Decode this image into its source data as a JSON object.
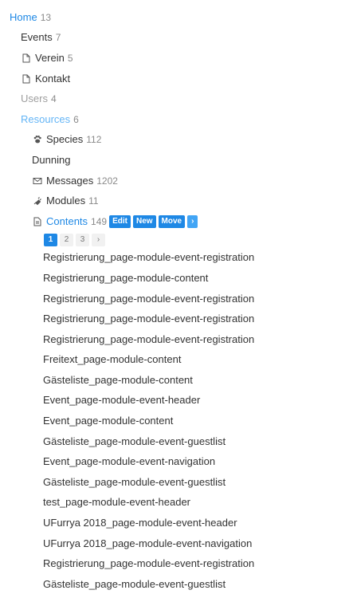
{
  "tree": {
    "home": {
      "label": "Home",
      "count": "13"
    },
    "events": {
      "label": "Events",
      "count": "7"
    },
    "verein": {
      "label": "Verein",
      "count": "5"
    },
    "kontakt": {
      "label": "Kontakt"
    },
    "users": {
      "label": "Users",
      "count": "4"
    },
    "resources": {
      "label": "Resources",
      "count": "6"
    },
    "species": {
      "label": "Species",
      "count": "112"
    },
    "dunning": {
      "label": "Dunning"
    },
    "messages": {
      "label": "Messages",
      "count": "1202"
    },
    "modules": {
      "label": "Modules",
      "count": "11"
    },
    "contents": {
      "label": "Contents",
      "count": "149",
      "actions": {
        "edit": "Edit",
        "new": "New",
        "move": "Move",
        "more": "›"
      },
      "pager": [
        "1",
        "2",
        "3",
        "›"
      ],
      "items": [
        "Registrierung_page-module-event-registration",
        "Registrierung_page-module-content",
        "Registrierung_page-module-event-registration",
        "Registrierung_page-module-event-registration",
        "Registrierung_page-module-event-registration",
        "Freitext_page-module-content",
        "Gästeliste_page-module-content",
        "Event_page-module-event-header",
        "Event_page-module-content",
        "Gästeliste_page-module-event-guestlist",
        "Event_page-module-event-navigation",
        "Gästeliste_page-module-event-guestlist",
        "test_page-module-event-header",
        "UFurrya 2018_page-module-event-header",
        "UFurrya 2018_page-module-event-navigation",
        "Registrierung_page-module-event-registration",
        "Gästeliste_page-module-event-guestlist"
      ]
    }
  },
  "colors": {
    "link": "#1e88e5",
    "linkLight": "#64b5f6",
    "muted": "#9e9e9e",
    "button": "#1e88e5"
  }
}
